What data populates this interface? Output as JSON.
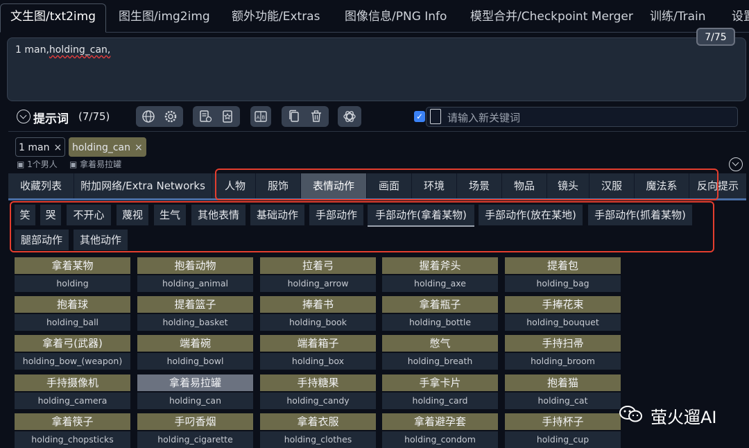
{
  "tabs": [
    "文生图/txt2img",
    "图生图/img2img",
    "额外功能/Extras",
    "图像信息/PNG Info",
    "模型合并/Checkpoint Merger",
    "训练/Train",
    "设置"
  ],
  "prompt": {
    "text_a": "1 man,",
    "text_b": "holding_can,",
    "token_counter": "7/75"
  },
  "toolbar": {
    "title": "提示词",
    "count": "(7/75)",
    "keyword_placeholder": "请输入新关键词"
  },
  "tags": [
    {
      "label": "1 man",
      "remove": "×",
      "translation": "1个男人"
    },
    {
      "label": "holding_can",
      "remove": "×",
      "translation": "拿着易拉罐"
    }
  ],
  "categories": [
    "收藏列表",
    "附加网络/Extra Networks",
    "人物",
    "服饰",
    "表情动作",
    "画面",
    "环境",
    "场景",
    "物品",
    "镜头",
    "汉服",
    "魔法系",
    "反向提示"
  ],
  "subtabs": [
    "笑",
    "哭",
    "不开心",
    "蔑视",
    "生气",
    "其他表情",
    "基础动作",
    "手部动作",
    "手部动作(拿着某物)",
    "手部动作(放在某地)",
    "手部动作(抓着某物)",
    "腿部动作",
    "其他动作"
  ],
  "cards": [
    {
      "cn": "拿着某物",
      "en": "holding"
    },
    {
      "cn": "抱着动物",
      "en": "holding_animal"
    },
    {
      "cn": "拉着弓",
      "en": "holding_arrow"
    },
    {
      "cn": "握着斧头",
      "en": "holding_axe"
    },
    {
      "cn": "提着包",
      "en": "holding_bag"
    },
    {
      "cn": "抱着球",
      "en": "holding_ball"
    },
    {
      "cn": "提着篮子",
      "en": "holding_basket"
    },
    {
      "cn": "捧着书",
      "en": "holding_book"
    },
    {
      "cn": "拿着瓶子",
      "en": "holding_bottle"
    },
    {
      "cn": "手捧花束",
      "en": "holding_bouquet"
    },
    {
      "cn": "拿着弓(武器)",
      "en": "holding_bow_(weapon)"
    },
    {
      "cn": "端着碗",
      "en": "holding_bowl"
    },
    {
      "cn": "端着箱子",
      "en": "holding_box"
    },
    {
      "cn": "憋气",
      "en": "holding_breath"
    },
    {
      "cn": "手持扫帚",
      "en": "holding_broom"
    },
    {
      "cn": "手持摄像机",
      "en": "holding_camera"
    },
    {
      "cn": "拿着易拉罐",
      "en": "holding_can"
    },
    {
      "cn": "手持糖果",
      "en": "holding_candy"
    },
    {
      "cn": "手拿卡片",
      "en": "holding_card"
    },
    {
      "cn": "抱着猫",
      "en": "holding_cat"
    },
    {
      "cn": "拿着筷子",
      "en": "holding_chopsticks"
    },
    {
      "cn": "手叼香烟",
      "en": "holding_cigarette"
    },
    {
      "cn": "拿着衣服",
      "en": "holding_clothes"
    },
    {
      "cn": "拿着避孕套",
      "en": "holding_condom"
    },
    {
      "cn": "手持杯子",
      "en": "holding_cup"
    }
  ],
  "watermark": "萤火遛AI",
  "colors": {
    "accent": "#e53e2e",
    "card_header": "#6c6a4a",
    "selected_card": "#6b7280",
    "checkbox": "#3b82f6"
  }
}
